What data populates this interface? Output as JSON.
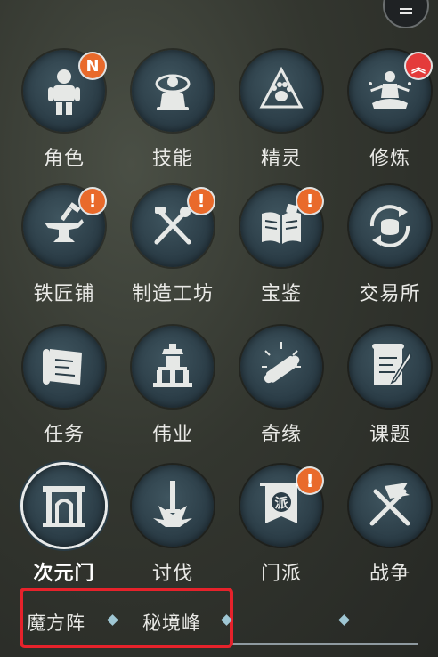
{
  "top_menu": {
    "icon": "menu-icon"
  },
  "features": [
    {
      "label": "角色",
      "icon": "knight-icon",
      "badge": "N",
      "badge_type": "new"
    },
    {
      "label": "技能",
      "icon": "skill-icon",
      "badge": "",
      "badge_type": ""
    },
    {
      "label": "精灵",
      "icon": "paw-icon",
      "badge": "",
      "badge_type": ""
    },
    {
      "label": "修炼",
      "icon": "meditation-icon",
      "badge": "︽",
      "badge_type": "upgrade"
    },
    {
      "label": "铁匠铺",
      "icon": "anvil-icon",
      "badge": "!",
      "badge_type": "alert"
    },
    {
      "label": "制造工坊",
      "icon": "tools-icon",
      "badge": "!",
      "badge_type": "alert"
    },
    {
      "label": "宝鉴",
      "icon": "book-icon",
      "badge": "!",
      "badge_type": "alert"
    },
    {
      "label": "交易所",
      "icon": "exchange-icon",
      "badge": "",
      "badge_type": ""
    },
    {
      "label": "任务",
      "icon": "scroll-map-icon",
      "badge": "",
      "badge_type": ""
    },
    {
      "label": "伟业",
      "icon": "monument-icon",
      "badge": "",
      "badge_type": ""
    },
    {
      "label": "奇缘",
      "icon": "scroll-glow-icon",
      "badge": "",
      "badge_type": ""
    },
    {
      "label": "课题",
      "icon": "scroll-quill-icon",
      "badge": "",
      "badge_type": ""
    },
    {
      "label": "次元门",
      "icon": "gate-icon",
      "badge": "",
      "badge_type": "",
      "selected": true
    },
    {
      "label": "讨伐",
      "icon": "sword-icon",
      "badge": "",
      "badge_type": ""
    },
    {
      "label": "门派",
      "icon": "faction-banner-icon",
      "badge": "!",
      "badge_type": "alert",
      "banner_char": "派"
    },
    {
      "label": "战争",
      "icon": "crossed-swords-icon",
      "badge": "",
      "badge_type": ""
    }
  ],
  "bottom_tabs": [
    {
      "label": "魔方阵"
    },
    {
      "label": "秘境峰"
    }
  ],
  "colors": {
    "highlight_box": "#e6222b",
    "badge_orange": "#e96a2b",
    "badge_red": "#e43b3b",
    "icon_bg": "#2c3e48"
  }
}
